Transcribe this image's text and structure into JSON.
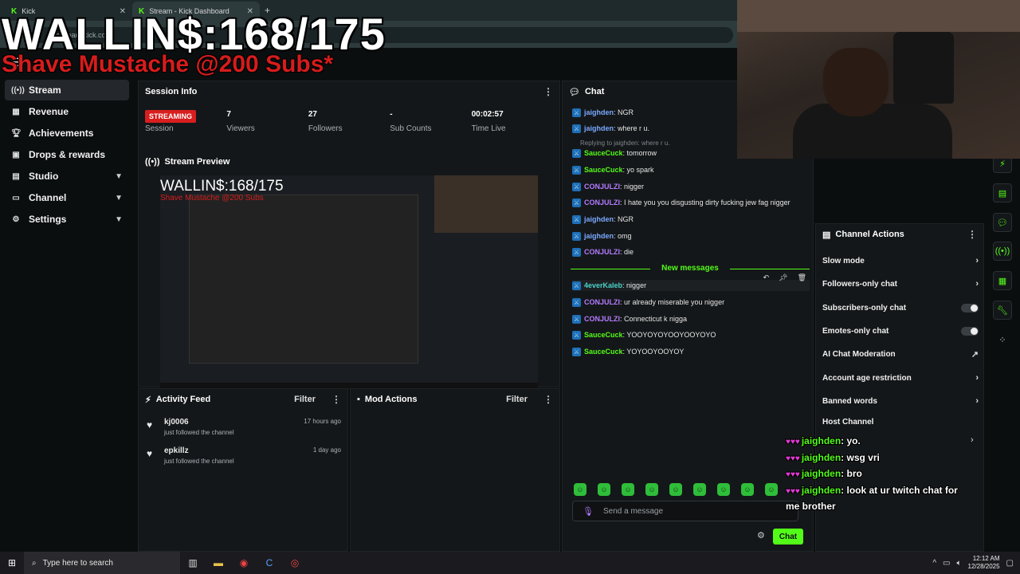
{
  "browser": {
    "tabs": [
      {
        "label": "Kick",
        "active": false
      },
      {
        "label": "Stream - Kick Dashboard",
        "active": true
      }
    ],
    "url": "dashboard.kick.com"
  },
  "overlay": {
    "goal": "WALLIN$:168/175",
    "subtitle": "Shave Mustache @200 Subs*",
    "chat": [
      {
        "user": "jaighden",
        "text": "yo."
      },
      {
        "user": "jaighden",
        "text": "wsg vri"
      },
      {
        "user": "jaighden",
        "text": "bro"
      },
      {
        "user": "jaighden",
        "text": "look at ur twitch chat for"
      },
      {
        "user": "",
        "text": "me brother"
      }
    ]
  },
  "sidebar": {
    "items": [
      {
        "label": "Stream",
        "icon": "broadcast-icon",
        "active": true
      },
      {
        "label": "Revenue",
        "icon": "revenue-icon"
      },
      {
        "label": "Achievements",
        "icon": "trophy-icon"
      },
      {
        "label": "Drops & rewards",
        "icon": "gift-icon"
      },
      {
        "label": "Studio",
        "icon": "studio-icon",
        "expandable": true
      },
      {
        "label": "Channel",
        "icon": "channel-icon",
        "expandable": true
      },
      {
        "label": "Settings",
        "icon": "gear-icon",
        "expandable": true
      }
    ]
  },
  "session": {
    "title": "Session Info",
    "status_badge": "STREAMING",
    "status_label": "Session",
    "viewers": "7",
    "viewers_label": "Viewers",
    "followers": "27",
    "followers_label": "Followers",
    "sub_counts": "-",
    "sub_counts_label": "Sub Counts",
    "time_live": "00:02:57",
    "time_live_label": "Time Live"
  },
  "preview": {
    "title": "Stream Preview",
    "goal": "WALLIN$:168/175",
    "subtitle": "Shave Mustache @200 Subs"
  },
  "activity": {
    "title": "Activity Feed",
    "filter": "Filter",
    "items": [
      {
        "user": "kj0006",
        "text": "just followed the channel",
        "time": "17 hours ago"
      },
      {
        "user": "epkillz",
        "text": "just followed the channel",
        "time": "1 day ago"
      }
    ]
  },
  "mod_actions": {
    "title": "Mod Actions",
    "filter": "Filter"
  },
  "chat": {
    "title": "Chat",
    "messages": [
      {
        "user": "jaighden",
        "color": "blue",
        "text": ": NGR"
      },
      {
        "user": "jaighden",
        "color": "blue",
        "text": ": where r u."
      },
      {
        "reply": "Replying to jaighden: where r u."
      },
      {
        "user": "SauceCuck",
        "color": "green",
        "text": ": tomorrow"
      },
      {
        "user": "SauceCuck",
        "color": "green",
        "text": ": yo spark"
      },
      {
        "user": "CONJULZI",
        "color": "purple",
        "text": ": nigger"
      },
      {
        "user": "CONJULZI",
        "color": "purple",
        "text": ": I hate you you disgusting dirty fucking jew fag nigger"
      },
      {
        "user": "jaighden",
        "color": "blue",
        "text": ": NGR"
      },
      {
        "user": "jaighden",
        "color": "blue",
        "text": ": omg"
      },
      {
        "user": "CONJULZI",
        "color": "purple",
        "text": ": die"
      },
      {
        "divider": "New messages"
      },
      {
        "user": "4everKaleb",
        "color": "teal",
        "text": ": nigger"
      },
      {
        "user": "CONJULZI",
        "color": "purple",
        "text": ": ur already miserable you nigger"
      },
      {
        "user": "CONJULZI",
        "color": "purple",
        "text": ": Connecticut k nigga"
      },
      {
        "user": "SauceCuck",
        "color": "green",
        "text": ": YOOYOYOYOOYOOYOYO"
      },
      {
        "user": "SauceCuck",
        "color": "green",
        "text": ": YOYOOYOOYOY"
      }
    ],
    "input_placeholder": "Send a message",
    "send_label": "Chat"
  },
  "channel_actions": {
    "title": "Channel Actions",
    "items": [
      {
        "label": "Slow mode",
        "control": "arrow"
      },
      {
        "label": "Followers-only chat",
        "control": "arrow"
      },
      {
        "label": "Subscribers-only chat",
        "control": "toggle"
      },
      {
        "label": "Emotes-only chat",
        "control": "toggle"
      },
      {
        "label": "AI Chat Moderation",
        "control": "external"
      },
      {
        "label": "Account age restriction",
        "control": "arrow"
      },
      {
        "label": "Banned words",
        "control": "arrow"
      },
      {
        "label": "Host Channel",
        "control": "arrow"
      }
    ]
  },
  "taskbar": {
    "search_placeholder": "Type here to search",
    "time": "12:12 AM",
    "date": "12/28/2025"
  },
  "colors": {
    "kick_green": "#53fc18",
    "streaming_red": "#d81e1e",
    "panel_bg": "#141719"
  }
}
